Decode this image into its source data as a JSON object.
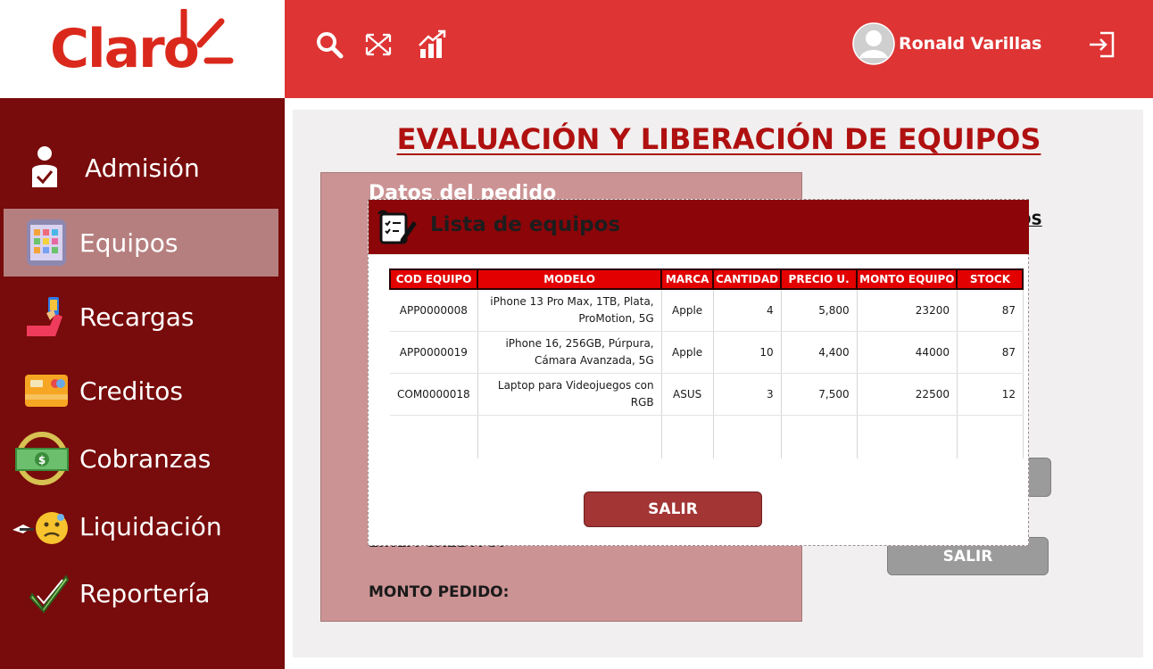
{
  "brand": {
    "name": "Claro"
  },
  "header": {
    "icons": [
      "search-icon",
      "shuffle-icon",
      "chart-growth-icon"
    ],
    "user_name": "Ronald Varillas",
    "logout_icon": "logout-icon"
  },
  "sidebar": {
    "items": [
      {
        "label": "Admisión",
        "icon": "admission-person-icon",
        "active": false
      },
      {
        "label": "Equipos",
        "icon": "phone-apps-icon",
        "active": true
      },
      {
        "label": "Recargas",
        "icon": "hand-phone-icon",
        "active": false
      },
      {
        "label": "Creditos",
        "icon": "credit-card-icon",
        "active": false
      },
      {
        "label": "Cobranzas",
        "icon": "money-bill-icon",
        "active": false
      },
      {
        "label": "Liquidación",
        "icon": "worried-face-icon",
        "active": false
      },
      {
        "label": "Reportería",
        "icon": "check-mark-icon",
        "active": false
      }
    ]
  },
  "main": {
    "title": "EVALUACIÓN Y LIBERACIÓN DE EQUIPOS",
    "form": {
      "heading": "Datos del pedido",
      "linea_credito": "LINEA CREDITO:",
      "monto_pedido": "MONTO PEDIDO:"
    },
    "link_fragment": "OS",
    "exit_label": "SALIR"
  },
  "modal": {
    "title": "Lista de equipos",
    "columns": [
      "COD EQUIPO",
      "MODELO",
      "MARCA",
      "CANTIDAD",
      "PRECIO U.",
      "MONTO EQUIPO",
      "STOCK"
    ],
    "rows": [
      {
        "cod": "APP0000008",
        "modelo_l1": "iPhone 13 Pro Max, 1TB, Plata,",
        "modelo_l2": "ProMotion, 5G",
        "marca": "Apple",
        "cantidad": "4",
        "precio": "5,800",
        "monto": "23200",
        "stock": "87"
      },
      {
        "cod": "APP0000019",
        "modelo_l1": "iPhone 16, 256GB, Púrpura,",
        "modelo_l2": "Cámara Avanzada, 5G",
        "marca": "Apple",
        "cantidad": "10",
        "precio": "4,400",
        "monto": "44000",
        "stock": "87"
      },
      {
        "cod": "COM0000018",
        "modelo_l1": "Laptop para Videojuegos con RGB",
        "modelo_l2": "",
        "marca": "ASUS",
        "cantidad": "3",
        "precio": "7,500",
        "monto": "22500",
        "stock": "12"
      }
    ],
    "exit_label": "SALIR"
  },
  "colors": {
    "topbar": "#de3434",
    "sidebar": "#780b0b",
    "sidebar_active": "#b67f7f",
    "title": "#b01010",
    "modal_header": "#8c0509",
    "table_header": "#e20000",
    "modal_button": "#a33535"
  }
}
